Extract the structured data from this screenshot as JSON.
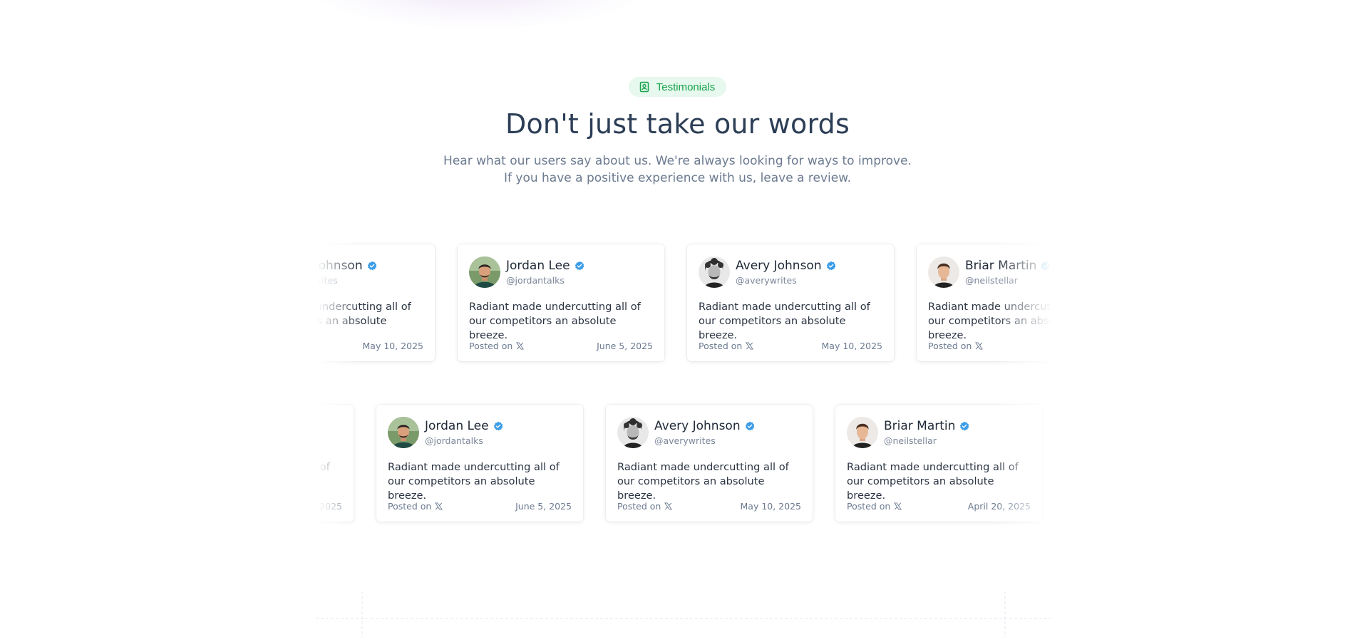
{
  "section": {
    "badge_label": "Testimonials",
    "headline": "Don't just take our words",
    "subtitle": "Hear what our users say about us. We're always looking for ways to improve. If you have a positive experience with us, leave a review."
  },
  "colors": {
    "badge_bg": "#e7f8ee",
    "badge_text": "#16a34a",
    "heading": "#2c3e56",
    "verified": "#3b9ce8"
  },
  "labels": {
    "posted_on": "Posted on"
  },
  "testimonials": [
    {
      "name": "Briar Martin",
      "handle": "@neilstellar",
      "quote": "Radiant made undercutting all of our competitors an absolute breeze.",
      "date": "April 20, 2025",
      "avatar": "avatar-briar"
    },
    {
      "name": "Avery Johnson",
      "handle": "@averywrites",
      "quote": "Radiant made undercutting all of our competitors an absolute breeze.",
      "date": "May 10, 2025",
      "avatar": "avatar-avery"
    },
    {
      "name": "Jordan Lee",
      "handle": "@jordantalks",
      "quote": "Radiant made undercutting all of our competitors an absolute breeze.",
      "date": "June 5, 2025",
      "avatar": "avatar-jordan"
    },
    {
      "name": "Avery Johnson",
      "handle": "@averywrites",
      "quote": "Radiant made undercutting all of our competitors an absolute breeze.",
      "date": "May 10, 2025",
      "avatar": "avatar-avery"
    }
  ]
}
